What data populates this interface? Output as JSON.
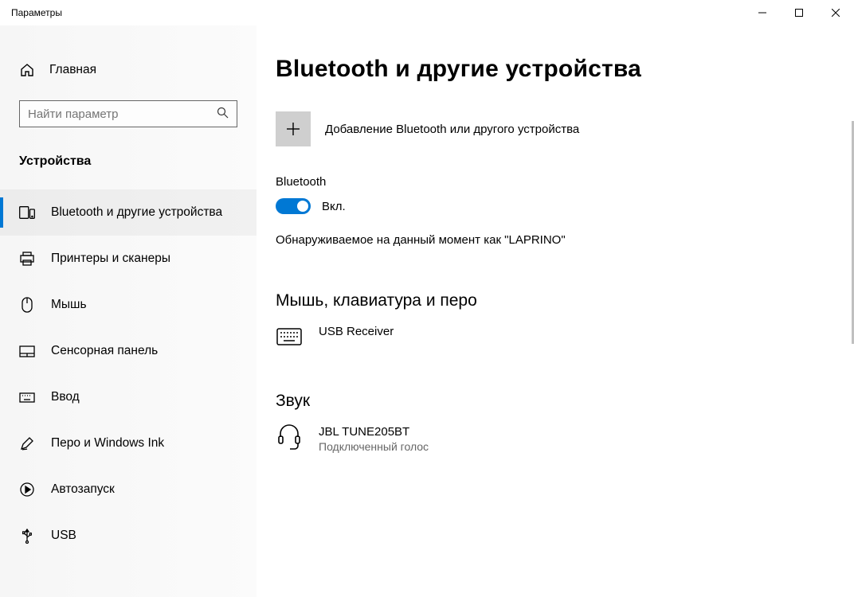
{
  "titlebar": {
    "title": "Параметры"
  },
  "sidebar": {
    "home_label": "Главная",
    "search_placeholder": "Найти параметр",
    "section_title": "Устройства",
    "items": [
      {
        "label": "Bluetooth и другие устройства",
        "active": true
      },
      {
        "label": "Принтеры и сканеры"
      },
      {
        "label": "Мышь"
      },
      {
        "label": "Сенсорная панель"
      },
      {
        "label": "Ввод"
      },
      {
        "label": "Перо и Windows Ink"
      },
      {
        "label": "Автозапуск"
      },
      {
        "label": "USB"
      }
    ]
  },
  "main": {
    "heading": "Bluetooth и другие устройства",
    "add_device_label": "Добавление Bluetooth или другого устройства",
    "bt_group_label": "Bluetooth",
    "toggle_state_label": "Вкл.",
    "discoverable_text": "Обнаруживаемое на данный момент как \"LAPRINO\"",
    "section_mouse": "Мышь, клавиатура и перо",
    "device_usb": {
      "name": "USB Receiver"
    },
    "section_sound": "Звук",
    "device_headset": {
      "name": "JBL TUNE205BT",
      "status": "Подключенный голос"
    }
  }
}
